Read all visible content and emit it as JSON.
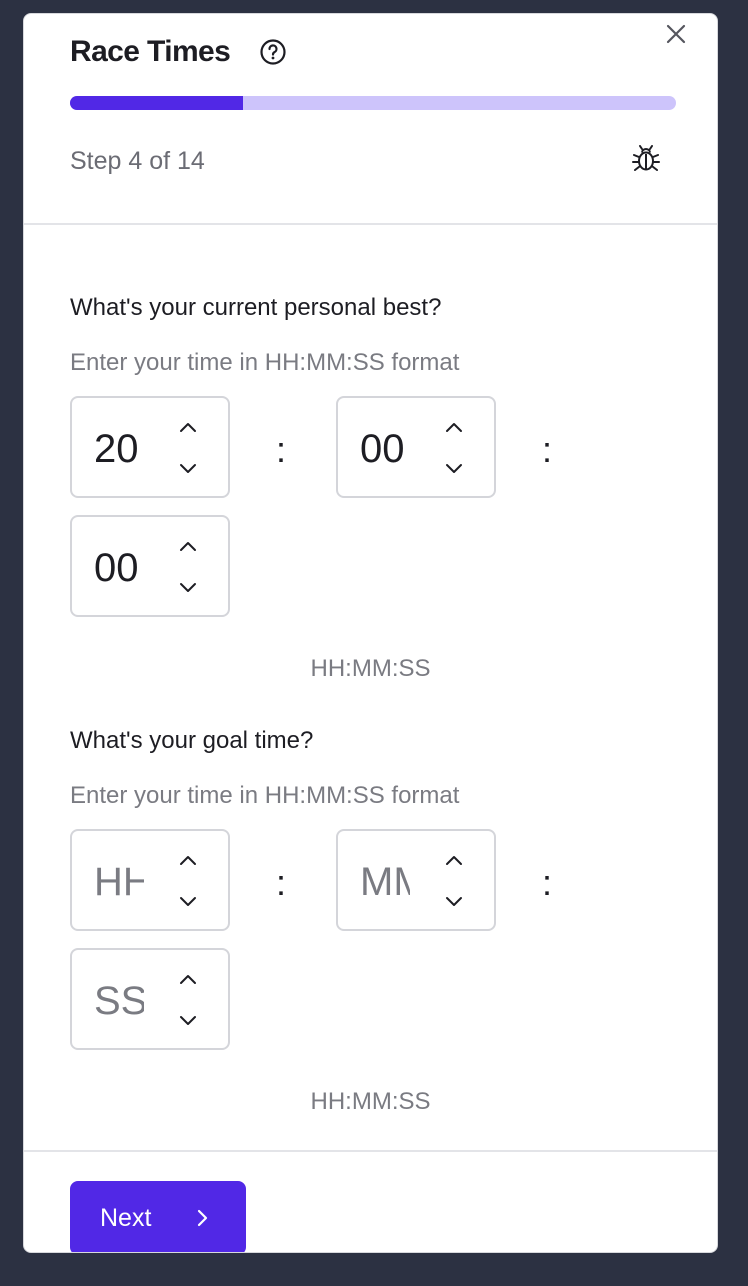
{
  "header": {
    "title": "Race Times",
    "step_text": "Step 4 of 14",
    "progress_fraction": 0.2857
  },
  "current_best": {
    "question": "What's your current personal best?",
    "hint": "Enter your time in HH:MM:SS format",
    "hours": "20",
    "minutes": "00",
    "seconds": "00",
    "format_label": "HH:MM:SS"
  },
  "goal": {
    "question": "What's your goal time?",
    "hint": "Enter your time in HH:MM:SS format",
    "hours_placeholder": "HH",
    "minutes_placeholder": "MM",
    "seconds_placeholder": "SS",
    "format_label": "HH:MM:SS"
  },
  "separator": ":",
  "footer": {
    "next_label": "Next"
  },
  "icons": {
    "help": "help-circle-icon",
    "close": "close-icon",
    "bug": "bug-icon",
    "up": "chevron-up-icon",
    "down": "chevron-down-icon",
    "next": "chevron-right-icon"
  },
  "colors": {
    "accent": "#5128e6",
    "progress_track": "#cdc4fb",
    "backdrop": "#2c3142"
  }
}
